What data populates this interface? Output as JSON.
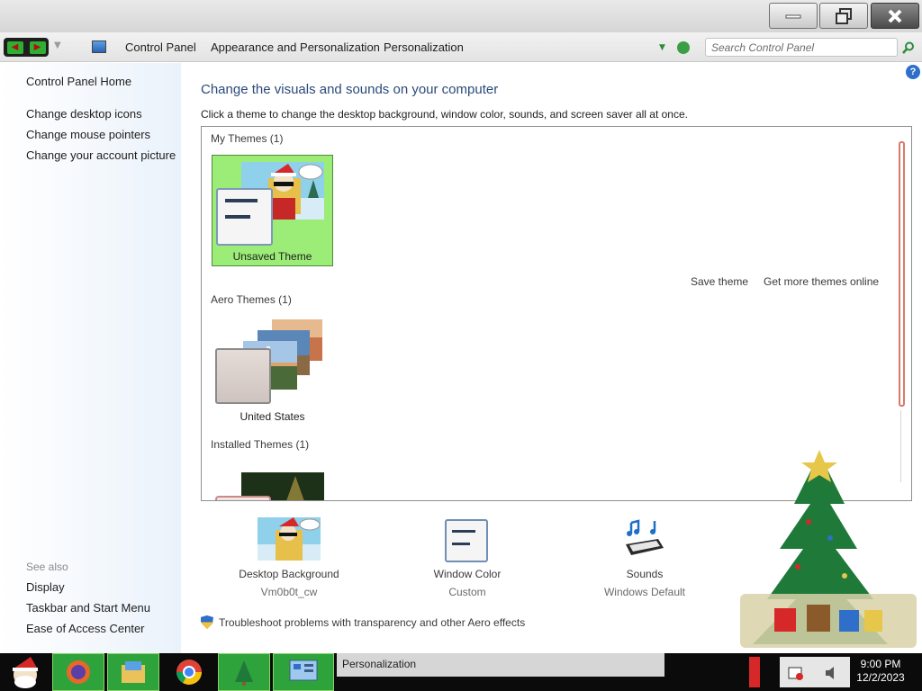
{
  "window": {
    "minimize_icon": "minimize-icon",
    "maximize_icon": "restore-icon",
    "close_icon": "close-icon"
  },
  "address_bar": {
    "breadcrumbs": [
      "Control Panel",
      "Appearance and Personalization",
      "Personalization"
    ],
    "search_placeholder": "Search Control Panel"
  },
  "left_pane": {
    "home_link": "Control Panel Home",
    "links": [
      "Change desktop icons",
      "Change mouse pointers",
      "Change your account picture"
    ],
    "see_also_title": "See also",
    "see_also_links": [
      "Display",
      "Taskbar and Start Menu",
      "Ease of Access Center"
    ]
  },
  "main": {
    "title": "Change the visuals and sounds on your computer",
    "subtitle": "Click a theme to change the desktop background, window color, sounds, and screen saver all at once.",
    "help_label": "?",
    "groups": {
      "my_themes": "My Themes (1)",
      "aero_themes": "Aero Themes (1)",
      "installed_themes": "Installed Themes (1)"
    },
    "themes": {
      "unsaved": "Unsaved Theme",
      "united_states": "United States"
    },
    "save_theme": "Save theme",
    "get_more_themes": "Get more themes online",
    "settings": [
      {
        "label": "Desktop Background",
        "value": "Vm0b0t_cw"
      },
      {
        "label": "Window Color",
        "value": "Custom"
      },
      {
        "label": "Sounds",
        "value": "Windows Default"
      }
    ],
    "troubleshoot": "Troubleshoot problems with transparency and other Aero effects"
  },
  "taskbar": {
    "active_task": "Personalization",
    "clock_time": "9:00 PM",
    "clock_date": "12/2/2023"
  },
  "colors": {
    "selected_theme_bg": "#9cec78",
    "title_text": "#2b4a7a",
    "scroll_thumb": "#d77a6a"
  }
}
